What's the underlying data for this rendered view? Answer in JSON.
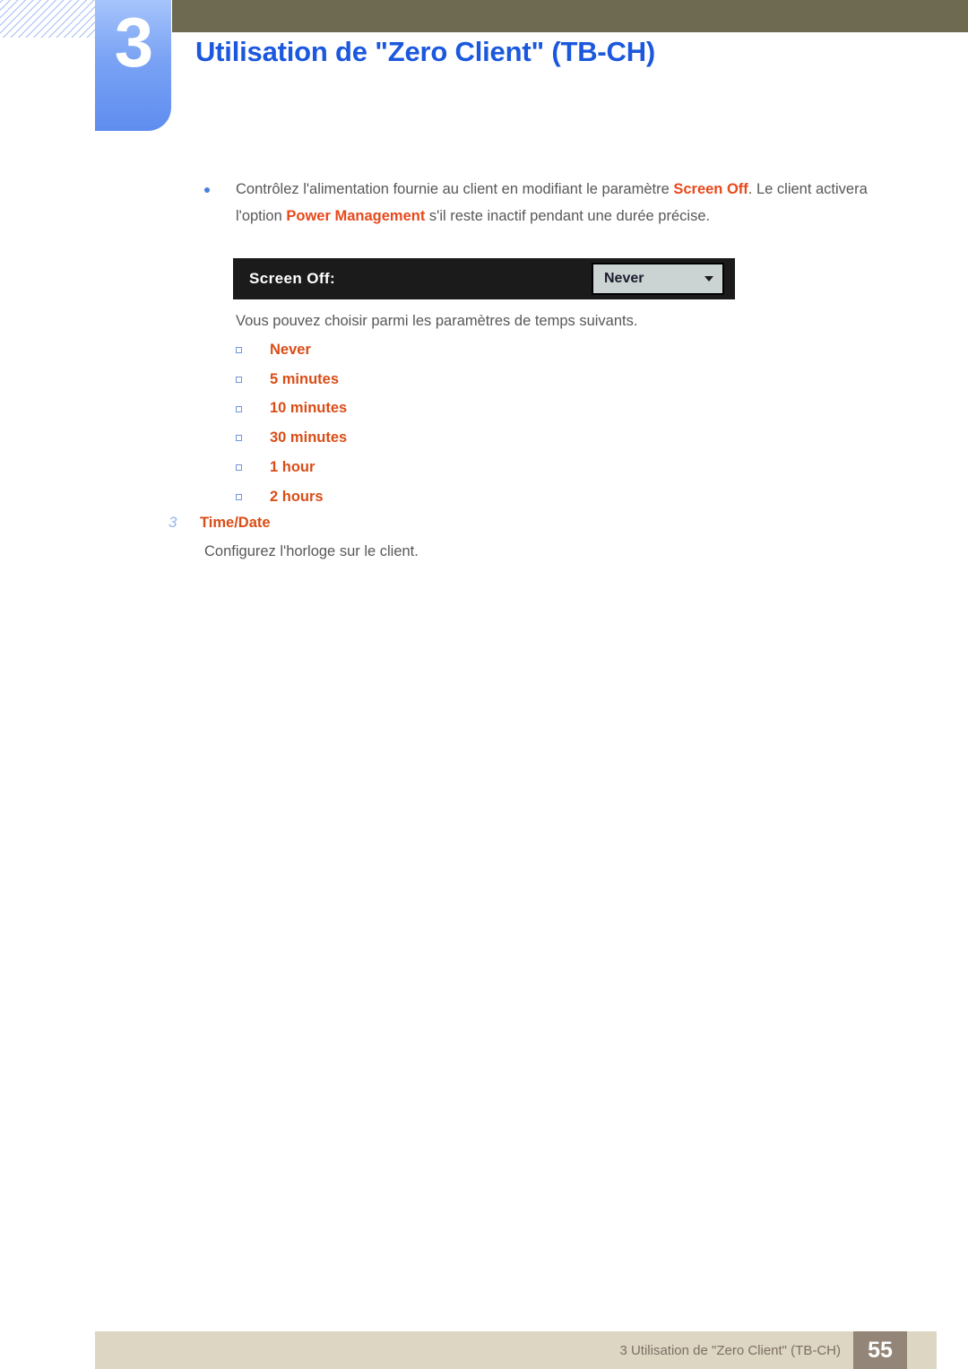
{
  "header": {
    "chapter_number": "3",
    "chapter_title": "Utilisation de \"Zero Client\" (TB-CH)",
    "accent_blue": "#1b58dd",
    "badge_blue": "#7aa3f4",
    "olive": "#6e6a51"
  },
  "main": {
    "bullet": {
      "text_part1": "Contrôlez l'alimentation fournie au client en modifiant le paramètre ",
      "highlight1": "Screen Off",
      "text_part2": ". Le client activera l'option ",
      "highlight2": "Power Management",
      "text_part3": " s'il reste inactif pendant une durée précise."
    },
    "widget": {
      "label": "Screen Off:",
      "selected_value": "Never",
      "arrow_icon": "chevron-down-icon",
      "background": "#1b1b1b",
      "combo_background": "#ccd4d3"
    },
    "sub_paragraph": "Vous pouvez choisir parmi les paramètres de temps suivants.",
    "options": [
      {
        "label": "Never"
      },
      {
        "label": "5 minutes"
      },
      {
        "label": "10 minutes"
      },
      {
        "label": "30 minutes"
      },
      {
        "label": "1 hour"
      },
      {
        "label": "2 hours"
      }
    ],
    "option_color": "#d94d16",
    "step": {
      "number": "3",
      "title": "Time/Date",
      "description": "Configurez l'horloge sur le client."
    }
  },
  "footer": {
    "text": "3 Utilisation de \"Zero Client\" (TB-CH)",
    "page_number": "55",
    "band_color": "#dcd6c3",
    "page_box_color": "#938578"
  }
}
